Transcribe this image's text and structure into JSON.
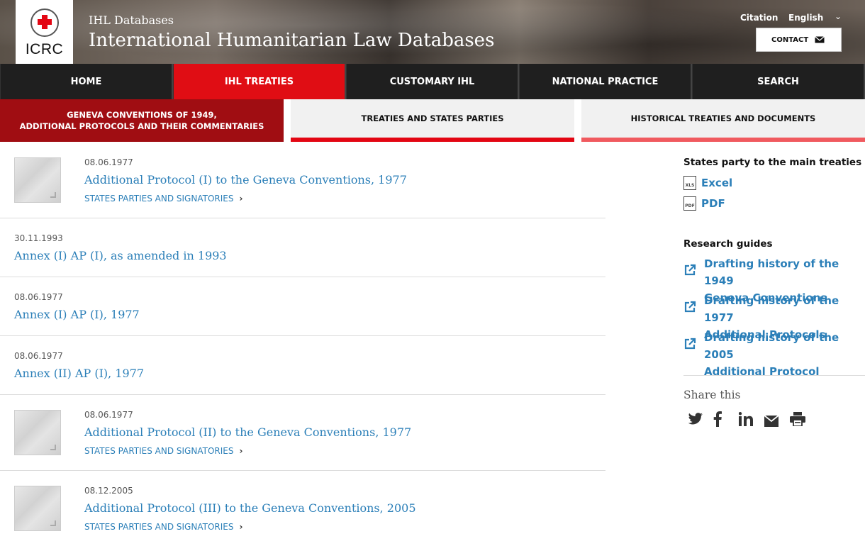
{
  "header": {
    "logo_text": "ICRC",
    "site_small": "IHL Databases",
    "site_title": "International Humanitarian Law Databases",
    "citation": "Citation",
    "language": "English",
    "contact": "CONTACT"
  },
  "nav": {
    "items": [
      {
        "label": "HOME"
      },
      {
        "label": "IHL TREATIES"
      },
      {
        "label": "CUSTOMARY IHL"
      },
      {
        "label": "NATIONAL PRACTICE"
      },
      {
        "label": "SEARCH"
      }
    ],
    "active_index": 1
  },
  "subnav": {
    "line1": "GENEVA CONVENTIONS OF 1949,",
    "line2": "ADDITIONAL PROTOCOLS AND THEIR COMMENTARIES",
    "treaties": "TREATIES AND STATES PARTIES",
    "historical": "HISTORICAL TREATIES AND DOCUMENTS"
  },
  "list": [
    {
      "date": "08.06.1977",
      "title": "Additional Protocol (I) to the Geneva Conventions, 1977",
      "link": "STATES PARTIES AND SIGNATORIES"
    },
    {
      "date": "30.11.1993",
      "title": "Annex (I) AP (I), as amended in 1993"
    },
    {
      "date": "08.06.1977",
      "title": "Annex (I) AP (I), 1977"
    },
    {
      "date": "08.06.1977",
      "title": "Annex (II) AP (I), 1977"
    },
    {
      "date": "08.06.1977",
      "title": "Additional Protocol (II) to the Geneva Conventions, 1977",
      "link": "STATES PARTIES AND SIGNATORIES"
    },
    {
      "date": "08.12.2005",
      "title": "Additional Protocol (III) to the Geneva Conventions, 2005",
      "link": "STATES PARTIES AND SIGNATORIES"
    }
  ],
  "sidebar": {
    "states_heading": "States party to the main treaties",
    "excel": "Excel",
    "pdf": "PDF",
    "research_heading": "Research guides",
    "guides": [
      {
        "line1": "Drafting history of the 1949",
        "line2": "Geneva Conventions"
      },
      {
        "line1": "Drafting history of the 1977",
        "line2": "Additional Protocols"
      },
      {
        "line1": "Drafting history of the 2005",
        "line2": "Additional Protocol"
      }
    ],
    "share_heading": "Share this",
    "share_icons": [
      "twitter-icon",
      "facebook-icon",
      "linkedin-icon",
      "email-icon",
      "print-icon"
    ]
  },
  "colors": {
    "red": "#e00d14",
    "dark_red": "#a00d12",
    "link_blue": "#2b7fb8",
    "nav_dark": "#1f1f1f"
  }
}
